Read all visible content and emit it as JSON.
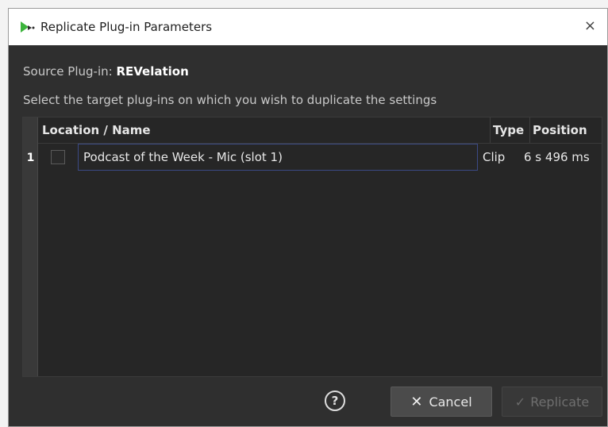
{
  "window": {
    "title": "Replicate Plug-in Parameters",
    "close_glyph": "×",
    "app_icon": "replicate-app-icon"
  },
  "source": {
    "label": "Source Plug-in: ",
    "value": "REVelation"
  },
  "instruction": "Select the target plug-ins on which you wish to duplicate the settings",
  "table": {
    "columns": [
      "Location / Name",
      "Type",
      "Position"
    ],
    "rows": [
      {
        "index": "1",
        "checked": false,
        "name": "Podcast of the Week - Mic (slot 1)",
        "type": "Clip",
        "position": "6 s 496 ms"
      }
    ]
  },
  "buttons": {
    "help_glyph": "?",
    "cancel_icon": "✕",
    "cancel_label": "Cancel",
    "replicate_icon": "✓",
    "replicate_label": "Replicate"
  },
  "colors": {
    "dialog_bg": "#2f2f2f",
    "table_bg": "#262626",
    "selection_border": "#3b4a86",
    "titlebar_bg": "#ffffff",
    "icon_green": "#3cb43c"
  }
}
